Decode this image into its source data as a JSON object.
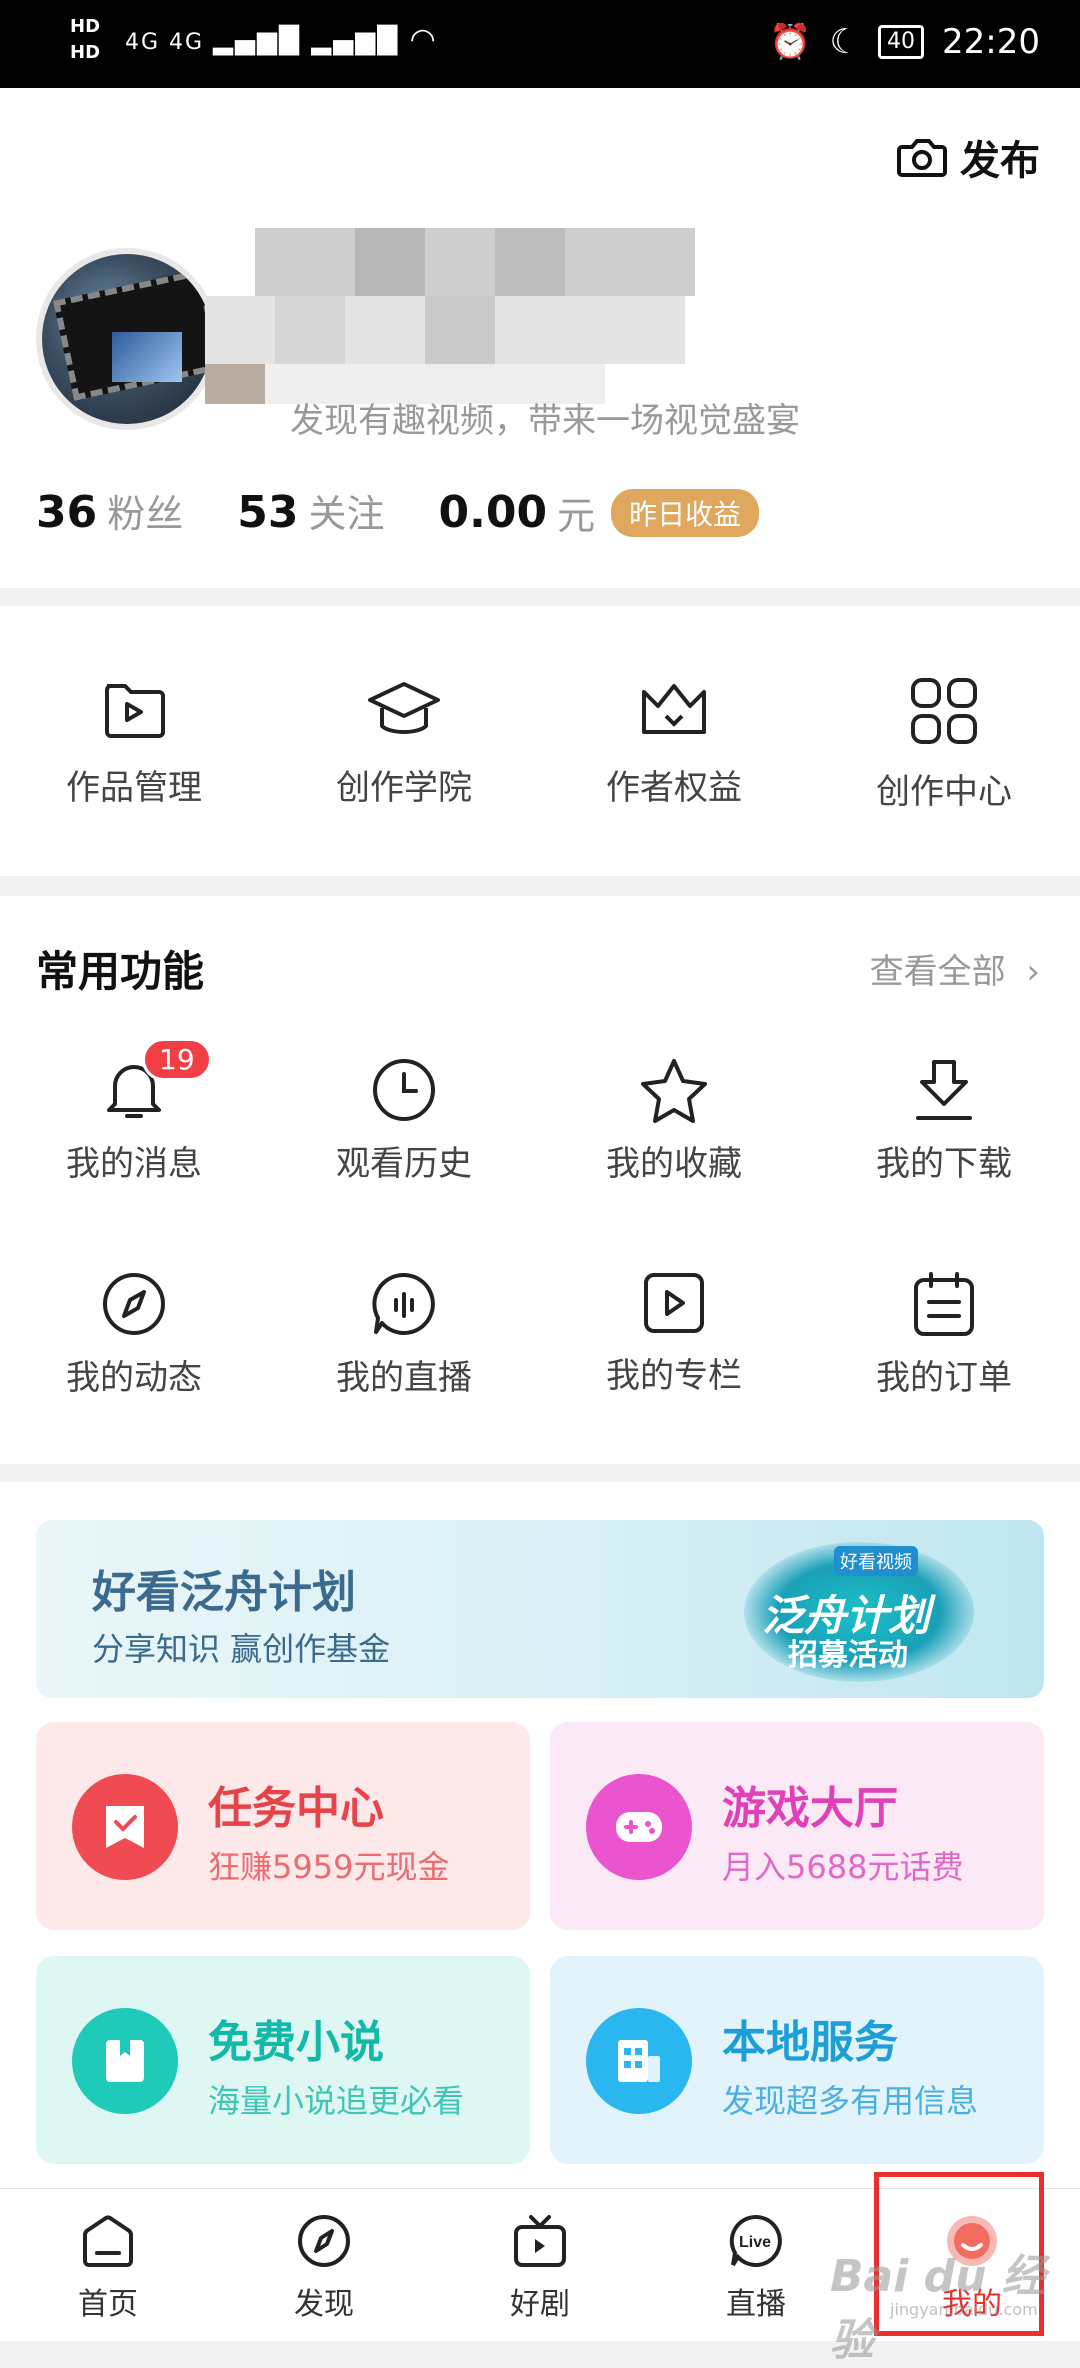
{
  "status_bar": {
    "hd1": "HD",
    "hd2": "HD",
    "signal_text": "4G 4G",
    "battery": "40",
    "time": "22:20"
  },
  "profile": {
    "publish_label": "发布",
    "bio": "发现有趣视频，带来一场视觉盛宴",
    "fans_count": "36",
    "fans_label": "粉丝",
    "follow_count": "53",
    "follow_label": "关注",
    "earnings_value": "0.00",
    "earnings_unit": "元",
    "earnings_badge": "昨日收益"
  },
  "creator_tools": [
    {
      "label": "作品管理",
      "icon": "video-folder-icon"
    },
    {
      "label": "创作学院",
      "icon": "graduation-cap-icon"
    },
    {
      "label": "作者权益",
      "icon": "crown-icon"
    },
    {
      "label": "创作中心",
      "icon": "grid-icon"
    }
  ],
  "common": {
    "title": "常用功能",
    "view_all": "查看全部",
    "items": [
      {
        "label": "我的消息",
        "icon": "bell-icon",
        "badge": "19"
      },
      {
        "label": "观看历史",
        "icon": "clock-icon"
      },
      {
        "label": "我的收藏",
        "icon": "star-icon"
      },
      {
        "label": "我的下载",
        "icon": "download-icon"
      },
      {
        "label": "我的动态",
        "icon": "compass-icon"
      },
      {
        "label": "我的直播",
        "icon": "live-audio-icon"
      },
      {
        "label": "我的专栏",
        "icon": "play-square-icon"
      },
      {
        "label": "我的订单",
        "icon": "order-list-icon"
      }
    ]
  },
  "banner": {
    "title": "好看泛舟计划",
    "subtitle": "分享知识 赢创作基金",
    "art_tag": "好看视频",
    "art_title": "泛舟计划",
    "art_sub": "招募活动"
  },
  "cards": [
    {
      "title": "任务中心",
      "subtitle": "狂赚5959元现金",
      "title_color": "#e8424a",
      "sub_color": "#ea6b70",
      "bg": "#fde9e9",
      "circle": "#f04b52",
      "icon": "task-icon"
    },
    {
      "title": "游戏大厅",
      "subtitle": "月入5688元话费",
      "title_color": "#e040b8",
      "sub_color": "#e068c6",
      "bg": "#fbeaf6",
      "circle": "#ea55cf",
      "icon": "gamepad-icon"
    },
    {
      "title": "免费小说",
      "subtitle": "海量小说追更必看",
      "title_color": "#12b8a8",
      "sub_color": "#3fc4b6",
      "bg": "#def7f3",
      "circle": "#1fcab8",
      "icon": "book-icon"
    },
    {
      "title": "本地服务",
      "subtitle": "发现超多有用信息",
      "title_color": "#1c9fd8",
      "sub_color": "#49b0e0",
      "bg": "#e2f3fb",
      "circle": "#2ab6ee",
      "icon": "building-icon"
    }
  ],
  "nav": [
    {
      "label": "首页",
      "icon": "home-icon"
    },
    {
      "label": "发现",
      "icon": "compass-icon"
    },
    {
      "label": "好剧",
      "icon": "tv-icon"
    },
    {
      "label": "直播",
      "icon": "live-icon"
    },
    {
      "label": "我的",
      "icon": "profile-icon"
    }
  ],
  "watermark": {
    "main": "Bai du 经验",
    "sub": "jingyan.baidu.com"
  }
}
